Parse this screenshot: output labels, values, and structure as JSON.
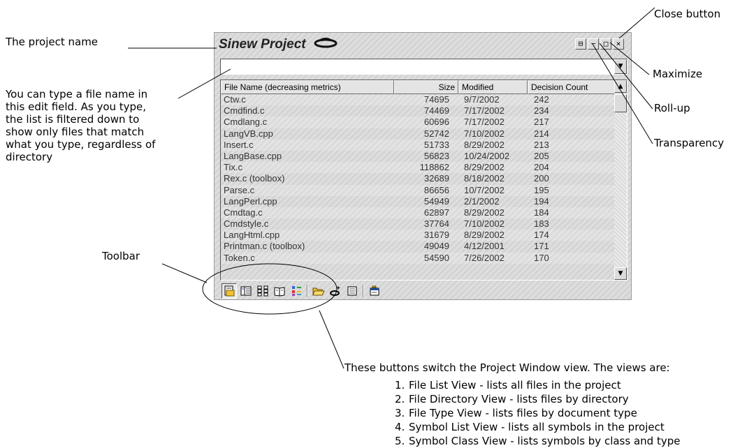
{
  "callouts": {
    "project_name": "The project name",
    "edit_field": [
      "You can type a file name in",
      "this edit field.  As you type,",
      "the list is filtered down to",
      "show only files that match",
      "what you type, regardless of",
      "directory"
    ],
    "toolbar": "Toolbar",
    "close_button": "Close button",
    "maximize": "Maximize",
    "roll_up": "Roll-up",
    "transparency": "Transparency",
    "views_intro": "These buttons switch the Project Window view.  The views are:",
    "views": [
      {
        "num": "1.",
        "text": "File List View - lists all files in the project"
      },
      {
        "num": "2.",
        "text": "File Directory View - lists files by directory"
      },
      {
        "num": "3.",
        "text": "File Type View - lists files by document type"
      },
      {
        "num": "4.",
        "text": "Symbol List View - lists all symbols in the project"
      },
      {
        "num": "5.",
        "text": "Symbol Class View - lists symbols by class and type"
      }
    ]
  },
  "window": {
    "title": "Sinew Project",
    "filter_value": "",
    "title_buttons": {
      "transparency": "⊟",
      "rollup": "−",
      "maximize": "□",
      "close": "×"
    },
    "columns": [
      "File Name (decreasing metrics)",
      "Size",
      "Modified",
      "Decision Count"
    ],
    "rows": [
      {
        "name": "Ctw.c",
        "size": "74695",
        "modified": "9/7/2002",
        "count": "242"
      },
      {
        "name": "Cmdfind.c",
        "size": "74469",
        "modified": "7/17/2002",
        "count": "234"
      },
      {
        "name": "Cmdlang.c",
        "size": "60696",
        "modified": "7/17/2002",
        "count": "217"
      },
      {
        "name": "LangVB.cpp",
        "size": "52742",
        "modified": "7/10/2002",
        "count": "214"
      },
      {
        "name": "Insert.c",
        "size": "51733",
        "modified": "8/29/2002",
        "count": "213"
      },
      {
        "name": "LangBase.cpp",
        "size": "56823",
        "modified": "10/24/2002",
        "count": "205"
      },
      {
        "name": "Tix.c",
        "size": "118862",
        "modified": "8/29/2002",
        "count": "204"
      },
      {
        "name": "Rex.c (toolbox)",
        "size": "32689",
        "modified": "8/18/2002",
        "count": "200"
      },
      {
        "name": "Parse.c",
        "size": "86656",
        "modified": "10/7/2002",
        "count": "195"
      },
      {
        "name": "LangPerl.cpp",
        "size": "54949",
        "modified": "2/1/2002",
        "count": "194"
      },
      {
        "name": "Cmdtag.c",
        "size": "62897",
        "modified": "8/29/2002",
        "count": "184"
      },
      {
        "name": "Cmdstyle.c",
        "size": "37764",
        "modified": "7/10/2002",
        "count": "183"
      },
      {
        "name": "LangHtml.cpp",
        "size": "31679",
        "modified": "8/29/2002",
        "count": "174"
      },
      {
        "name": "Printman.c (toolbox)",
        "size": "49049",
        "modified": "4/12/2001",
        "count": "171"
      },
      {
        "name": "Token.c",
        "size": "54590",
        "modified": "7/26/2002",
        "count": "170"
      }
    ],
    "toolbar_icons": [
      "file-list-view-icon",
      "file-directory-view-icon",
      "file-type-view-icon",
      "symbol-list-view-icon",
      "symbol-class-view-icon",
      "open-folder-icon",
      "add-to-project-icon",
      "document-icon",
      "properties-icon"
    ]
  }
}
